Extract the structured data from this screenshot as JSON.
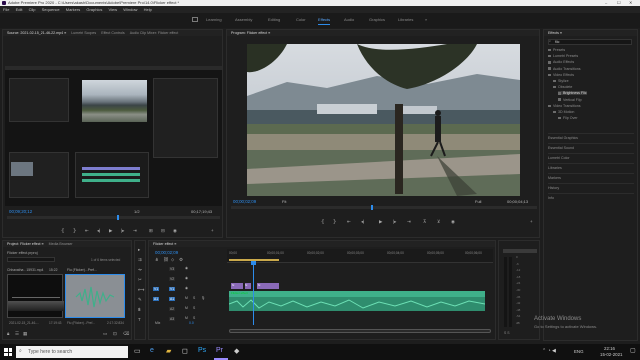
{
  "titlebar": {
    "title": "Adobe Premiere Pro 2020 - C:\\Users\\akash\\Documents\\Adobe\\Premiere Pro\\14.0\\Flicker effect *",
    "min": "–",
    "max": "☐",
    "close": "✕"
  },
  "menubar": [
    "File",
    "Edit",
    "Clip",
    "Sequence",
    "Markers",
    "Graphics",
    "View",
    "Window",
    "Help"
  ],
  "workspaces": {
    "items": [
      "Learning",
      "Assembly",
      "Editing",
      "Color",
      "Effects",
      "Audio",
      "Graphics",
      "Libraries"
    ],
    "active": "Effects",
    "more": "»"
  },
  "source": {
    "tabs": [
      "Source: 2021-02-15_21-46-22.mp4 ≡",
      "Lumetri Scopes",
      "Effect Controls",
      "Audio Clip Mixer: Flicker effect"
    ],
    "timecode_in": "00;09;20;12",
    "zoom": "1/2",
    "timecode_dur": "00;17;19;43"
  },
  "program": {
    "tab": "Program: Flicker effect ≡",
    "timecode": "00;00;02;09",
    "fit": "Fit",
    "quality": "Full",
    "duration": "00;00;04;13"
  },
  "project": {
    "tabs": [
      "Project: Flicker effect ≡",
      "Media Browser"
    ],
    "bin_label": "Flicker effect.prproj",
    "selected": "1 of 6 items selected",
    "clip1_name": "Chhavatha - 15931.mp4",
    "clip1_dur": "15:22",
    "clip2_name": "Flu (Flicker)...Pref...",
    "clip2_dur": "2:17:32:834",
    "thumb_label": "2021-02-15_21-46-...",
    "thumb_dur": "17:19:43"
  },
  "timeline": {
    "tab": "Flicker effect ≡",
    "timecode": "00;00;02;09",
    "ruler": [
      "00;00",
      "00;00;01;00",
      "00;00;02;00",
      "00;00;03;00",
      "00;00;04;00",
      "00;00;05;00",
      "00;00;06;00"
    ],
    "tracks": [
      "V3",
      "V2",
      "V1",
      "A1",
      "A2",
      "A3"
    ],
    "v2_clips": [
      "fx",
      "fx",
      "fx"
    ],
    "v1_clip": "Flicker effect",
    "mix": "Mix",
    "mix_value": "0.0"
  },
  "effects": {
    "tab": "Effects ≡",
    "search": "flic",
    "tree": [
      {
        "label": "Presets",
        "indent": 0
      },
      {
        "label": "Lumetri Presets",
        "indent": 0
      },
      {
        "label": "Audio Effects",
        "indent": 0
      },
      {
        "label": "Audio Transitions",
        "indent": 0
      },
      {
        "label": "Video Effects",
        "indent": 0
      },
      {
        "label": "Stylize",
        "indent": 1
      },
      {
        "label": "Obsolete",
        "indent": 1
      },
      {
        "label": "Brightness Flic",
        "indent": 2,
        "selected": true
      },
      {
        "label": "Vertical Flip",
        "indent": 2
      },
      {
        "label": "Video Transitions",
        "indent": 0
      },
      {
        "label": "3D Motion",
        "indent": 1
      },
      {
        "label": "Flip Over",
        "indent": 2
      }
    ],
    "panels": [
      "Essential Graphics",
      "Essential Sound",
      "Lumetri Color",
      "Libraries",
      "Markers",
      "History",
      "Info"
    ]
  },
  "audio_meter": {
    "scale": [
      "0",
      "-6",
      "-12",
      "-18",
      "-24",
      "-30",
      "-36",
      "-42",
      "-48",
      "-54",
      "dB"
    ],
    "solo": "S S"
  },
  "watermark": {
    "line1": "Activate Windows",
    "line2": "Go to Settings to activate Windows."
  },
  "taskbar": {
    "search_placeholder": "Type here to search",
    "lang": "ENG",
    "time": "22:16",
    "date": "15-02-2021"
  },
  "colors": {
    "accent": "#2d8ceb",
    "clip_green": "#3fb08a",
    "clip_purple": "#8a6ab8",
    "panel_bg": "#1e1e1e"
  }
}
